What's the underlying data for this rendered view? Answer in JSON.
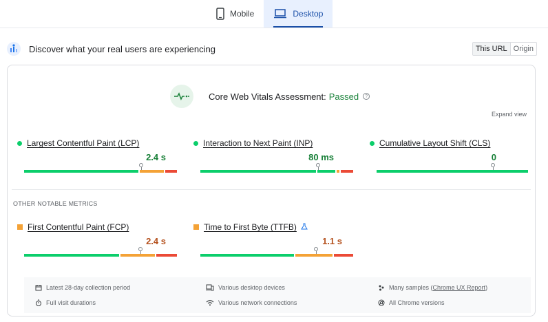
{
  "tabs": {
    "mobile_label": "Mobile",
    "desktop_label": "Desktop",
    "active": "desktop"
  },
  "header": {
    "title": "Discover what your real users are experiencing",
    "this_url_label": "This URL",
    "origin_label": "Origin"
  },
  "assessment": {
    "label": "Core Web Vitals Assessment:",
    "status": "Passed",
    "help": "?",
    "expand_label": "Expand view"
  },
  "core_metrics": [
    {
      "name": "Largest Contentful Paint (LCP)",
      "value": "2.4 s",
      "status": "good",
      "marker_fraction": 0.76,
      "segments": [
        0.75,
        0.17,
        0.08
      ]
    },
    {
      "name": "Interaction to Next Paint (INP)",
      "value": "80 ms",
      "status": "good",
      "marker_fraction": 0.76,
      "segments": [
        0.76,
        0.13,
        0.11
      ]
    },
    {
      "name": "Cumulative Layout Shift (CLS)",
      "value": "0",
      "status": "good",
      "marker_fraction": 0.76,
      "segments": [
        1.0,
        0,
        0
      ]
    }
  ],
  "other_metrics_label": "OTHER NOTABLE METRICS",
  "other_metrics": [
    {
      "name": "First Contentful Paint (FCP)",
      "value": "2.4 s",
      "status": "needs-improvement",
      "marker_fraction": 0.75,
      "segments": [
        0.63,
        0.23,
        0.14
      ]
    },
    {
      "name": "Time to First Byte (TTFB)",
      "value": "1.1 s",
      "status": "needs-improvement",
      "marker_fraction": 0.75,
      "segments": [
        0.62,
        0.25,
        0.13
      ]
    }
  ],
  "footer": {
    "collection_period": "Latest 28-day collection period",
    "visit_durations": "Full visit durations",
    "devices": "Various desktop devices",
    "network": "Various network connections",
    "samples_prefix": "Many samples (",
    "samples_link": "Chrome UX Report",
    "samples_suffix": ")",
    "chrome_versions": "All Chrome versions"
  },
  "colors": {
    "good": "#0cce6b",
    "needs_improvement": "#f4a236",
    "poor": "#eb4a36",
    "accent": "#1a4fa8",
    "passed": "#188038"
  },
  "icons": [
    "phone-icon",
    "laptop-icon",
    "crux-logo-icon",
    "pulse-icon",
    "help-icon",
    "flask-icon",
    "calendar-icon",
    "devices-icon",
    "samples-icon",
    "stopwatch-icon",
    "wifi-icon",
    "chrome-icon"
  ]
}
